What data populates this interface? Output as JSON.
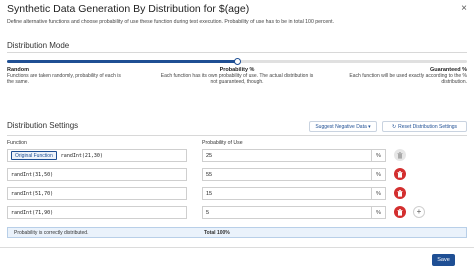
{
  "dialog": {
    "title": "Synthetic Data Generation By Distribution for $(age)",
    "close_glyph": "×",
    "description": "Define alternative functions and choose probability of use these function during test execution. Probability of use has to be in total 100 percent."
  },
  "distribution_mode": {
    "title": "Distribution Mode",
    "value": 0.5,
    "modes": [
      {
        "name": "Random",
        "description": "Functions are taken randomly, probability of each is the same."
      },
      {
        "name": "Probability %",
        "description": "Each function has its own probability of use. The actual distribution is not guaranteed, though."
      },
      {
        "name": "Guaranteed %",
        "description": "Each function will be used exactly according to the % distribution."
      }
    ]
  },
  "distribution_settings": {
    "title": "Distribution Settings",
    "suggest_button": "Suggest Negative Data ▾",
    "reset_button": "Reset Distribution Settings",
    "reset_icon": "↻",
    "function_label": "Function",
    "probability_label": "Probability of Use",
    "percent_sign": "%",
    "original_function_label": "Original Function",
    "rows": [
      {
        "function": "randInt(21,30)",
        "probability": "25"
      },
      {
        "function": "randInt(31,50)",
        "probability": "55"
      },
      {
        "function": "randInt(51,70)",
        "probability": "15"
      },
      {
        "function": "randInt(71,90)",
        "probability": "5"
      }
    ],
    "add_glyph": "+"
  },
  "status": {
    "message": "Probability is correctly distributed.",
    "total": "Total 100%"
  },
  "footer": {
    "save_label": "Save"
  },
  "colors": {
    "accent": "#1f4f94",
    "danger": "#d32f2f",
    "info_bg": "#eaf2fb"
  }
}
